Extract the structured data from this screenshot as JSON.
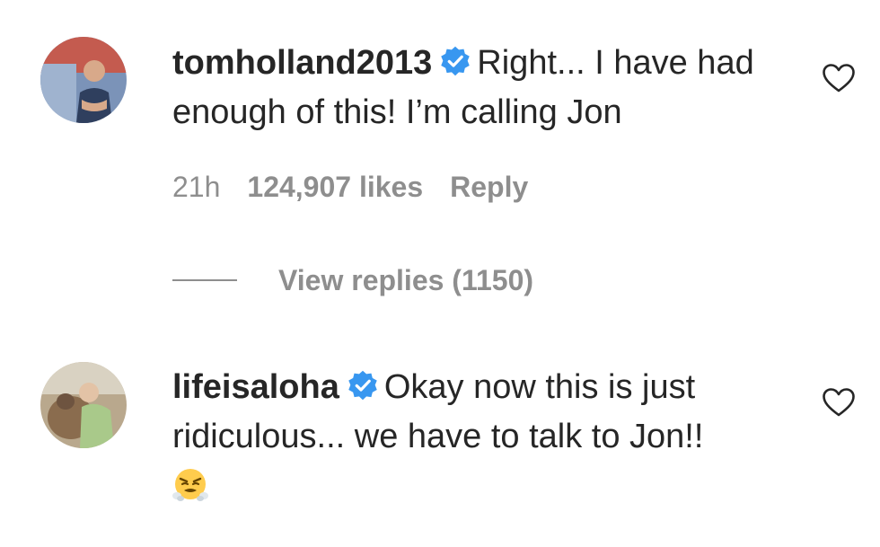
{
  "comments": [
    {
      "username": "tomholland2013",
      "verified": true,
      "text": "Right... I have had enough of this! I’m calling Jon",
      "time": "21h",
      "likes": "124,907 likes",
      "reply_label": "Reply",
      "view_replies": "View replies (1150)",
      "avatar_icon": "avatar-photo"
    },
    {
      "username": "lifeisaloha",
      "verified": true,
      "text": "Okay now this is just ridiculous... we have to talk to Jon!!",
      "emoji": "😤",
      "avatar_icon": "avatar-photo"
    }
  ],
  "colors": {
    "text": "#262626",
    "secondary": "#8e8e8e",
    "verified_blue": "#3897f0"
  },
  "icons": {
    "verified": "verified-badge-icon",
    "like": "heart-outline-icon"
  }
}
